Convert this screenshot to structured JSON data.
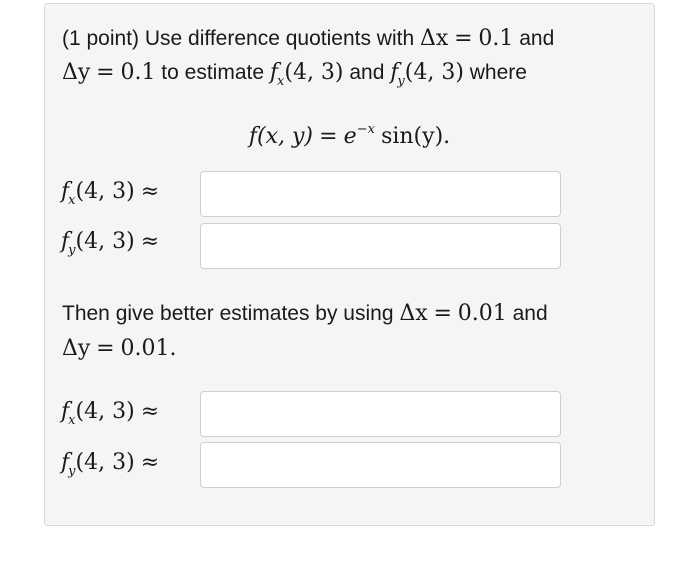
{
  "intro": {
    "point_label": "(1 point) Use difference quotients with",
    "delta_x": "Δx",
    "equals": "=",
    "step": "0.1",
    "and_word": "and",
    "delta_y": "Δy",
    "to_estimate": "to estimate",
    "f": "f",
    "sub_x": "x",
    "sub_y": "y",
    "point": "(4, 3)",
    "where_word": "where"
  },
  "equation": {
    "lhs": "f(x, y)",
    "equals": "=",
    "base": "e",
    "exponent": "−x",
    "sin": "sin(y)",
    "period": "."
  },
  "rows": {
    "approx": "≈",
    "fx_label_f": "f",
    "fx_label_sub": "x",
    "fy_label_f": "f",
    "fy_label_sub": "y",
    "arg": "(4, 3)"
  },
  "better": {
    "text": "Then give better estimates by using",
    "delta_x": "Δx",
    "equals": "=",
    "step": "0.01",
    "and_word": "and",
    "delta_y": "Δy",
    "period": "."
  },
  "inputs": {
    "fx_1": "",
    "fy_1": "",
    "fx_2": "",
    "fy_2": ""
  }
}
